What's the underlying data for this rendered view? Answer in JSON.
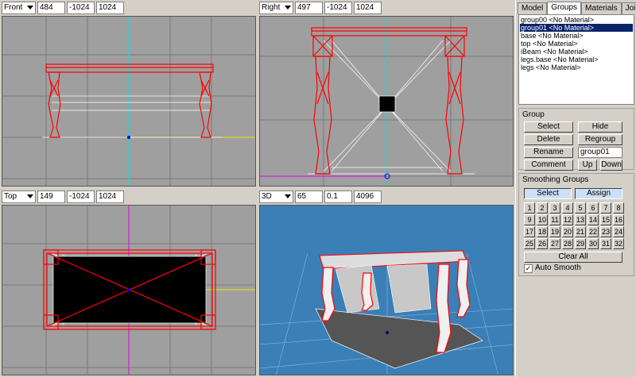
{
  "viewports": [
    {
      "id": "front",
      "mode": "Front",
      "value1": "484",
      "value2": "-1024",
      "value3": "1024"
    },
    {
      "id": "right",
      "mode": "Right",
      "value1": "497",
      "value2": "-1024",
      "value3": "1024"
    },
    {
      "id": "top",
      "mode": "Top",
      "value1": "149",
      "value2": "-1024",
      "value3": "1024"
    },
    {
      "id": "persp",
      "mode": "3D",
      "value1": "65",
      "value2": "0.1",
      "value3": "4096"
    }
  ],
  "tabs": [
    "Model",
    "Groups",
    "Materials",
    "Joints"
  ],
  "active_tab": "Groups",
  "groups": [
    "group00 <No Material>",
    "group01 <No Material>",
    "base <No Material>",
    "top <No Material>",
    "iBeam <No Material>",
    "legs.base <No Material>",
    "legs <No Material>"
  ],
  "selected_group_index": 1,
  "group_box": {
    "title": "Group",
    "select_label": "Select",
    "hide_label": "Hide",
    "delete_label": "Delete",
    "regroup_label": "Regroup",
    "rename_label": "Rename",
    "name_value": "group01",
    "comment_label": "Comment",
    "up_label": "Up",
    "down_label": "Down"
  },
  "smoothing_box": {
    "title": "Smoothing Groups",
    "select_label": "Select",
    "assign_label": "Assign",
    "numbers": [
      "1",
      "2",
      "3",
      "4",
      "5",
      "6",
      "7",
      "8",
      "9",
      "10",
      "11",
      "12",
      "13",
      "14",
      "15",
      "16",
      "17",
      "18",
      "19",
      "20",
      "21",
      "22",
      "23",
      "24",
      "25",
      "26",
      "27",
      "28",
      "29",
      "30",
      "31",
      "32"
    ],
    "clear_all_label": "Clear All",
    "auto_smooth_label": "Auto Smooth",
    "auto_smooth_checked": true,
    "check_mark": "✓"
  },
  "colors": {
    "ortho_bg": "#9f9f9f",
    "persp_bg": "#3a7fb6",
    "wire_red": "#ff0000",
    "wire_white": "#ffffff",
    "axis_cyan": "#00e0e0",
    "axis_yellow": "#e8e800",
    "axis_magenta": "#e000e0"
  }
}
